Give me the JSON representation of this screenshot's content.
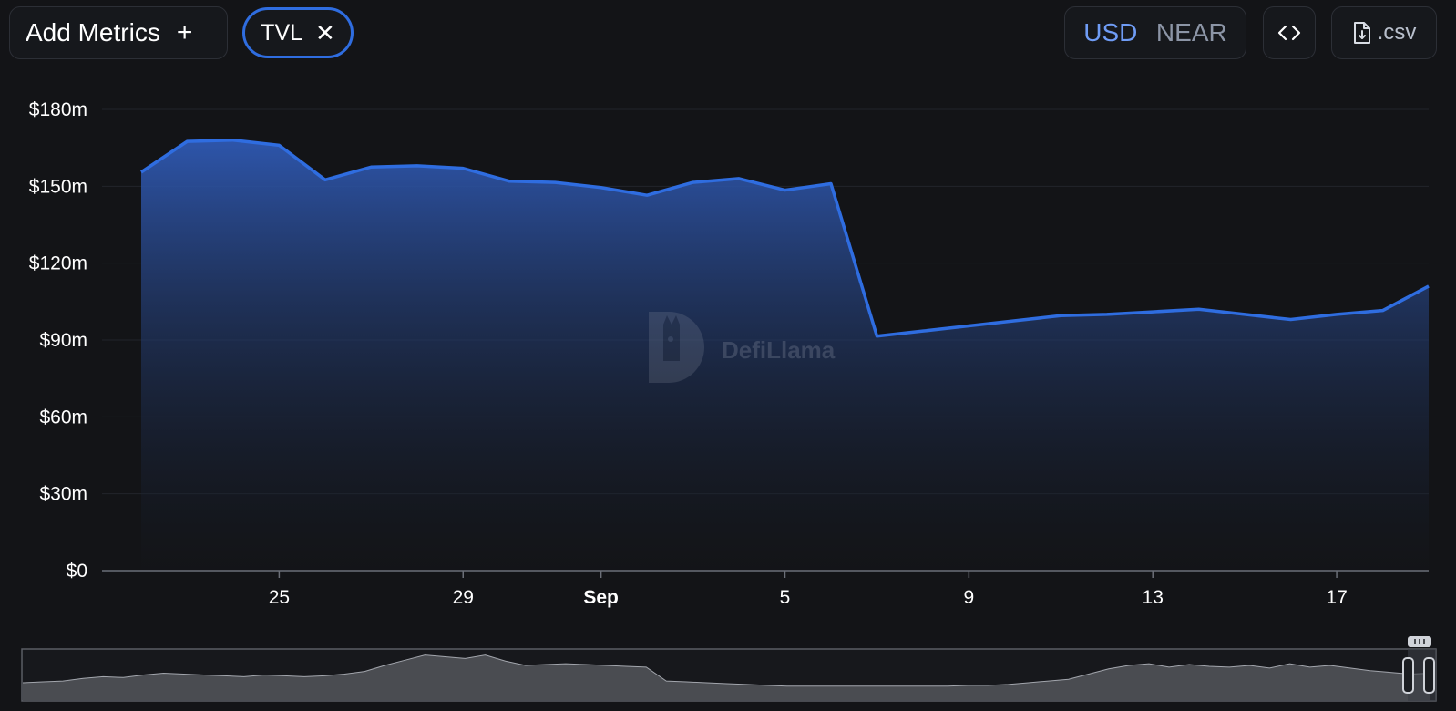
{
  "toolbar": {
    "add_metrics_label": "Add Metrics",
    "add_icon": "plus-icon",
    "metric_pill_label": "TVL",
    "remove_icon": "close-icon",
    "currency_options": [
      "USD",
      "NEAR"
    ],
    "currency_selected": "USD",
    "embed_icon": "code-icon",
    "csv_label": ".csv",
    "csv_icon": "file-download-icon"
  },
  "watermark": {
    "text": "DefiLlama",
    "icon": "llama-logo-icon"
  },
  "colors": {
    "background": "#131417",
    "line": "#2f6de0",
    "accent": "#6f9cf5",
    "brush_fill": "#4a4c51",
    "brush_line": "#a3a6ad"
  },
  "chart_data": {
    "type": "area",
    "x": [
      "2024-08-22",
      "2024-08-23",
      "2024-08-24",
      "2024-08-25",
      "2024-08-26",
      "2024-08-27",
      "2024-08-28",
      "2024-08-29",
      "2024-08-30",
      "2024-08-31",
      "2024-09-01",
      "2024-09-02",
      "2024-09-03",
      "2024-09-04",
      "2024-09-05",
      "2024-09-06",
      "2024-09-07",
      "2024-09-08",
      "2024-09-09",
      "2024-09-10",
      "2024-09-11",
      "2024-09-12",
      "2024-09-13",
      "2024-09-14",
      "2024-09-15",
      "2024-09-16",
      "2024-09-17",
      "2024-09-18",
      "2024-09-19"
    ],
    "series": [
      {
        "values": [
          155.5,
          167.5,
          168,
          166,
          152.5,
          157.5,
          158,
          157,
          152,
          151.5,
          149.5,
          146.5,
          151.5,
          153,
          148.5,
          151,
          91.5,
          93.5,
          95.5,
          97.5,
          99.5,
          100,
          101,
          102,
          100,
          98,
          100,
          101.5,
          111
        ]
      }
    ],
    "ylim": [
      0,
      180
    ],
    "y_ticks": [
      "$0",
      "$30m",
      "$60m",
      "$90m",
      "$120m",
      "$150m",
      "$180m"
    ],
    "x_ticks": [
      {
        "label": "25",
        "date": "2024-08-25",
        "bold": false
      },
      {
        "label": "29",
        "date": "2024-08-29",
        "bold": false
      },
      {
        "label": "Sep",
        "date": "2024-09-01",
        "bold": true
      },
      {
        "label": "5",
        "date": "2024-09-05",
        "bold": false
      },
      {
        "label": "9",
        "date": "2024-09-09",
        "bold": false
      },
      {
        "label": "13",
        "date": "2024-09-13",
        "bold": false
      },
      {
        "label": "17",
        "date": "2024-09-17",
        "bold": false
      }
    ],
    "grid": true,
    "legend": "none",
    "brush": {
      "overview_values": [
        20,
        21,
        22,
        25,
        27,
        26,
        29,
        31,
        30,
        29,
        28,
        27,
        29,
        28,
        27,
        28,
        30,
        33,
        40,
        46,
        52,
        50,
        48,
        52,
        45,
        40,
        41,
        42,
        41,
        40,
        39,
        38,
        22,
        21,
        20,
        19,
        18,
        17,
        16,
        16,
        16,
        16,
        16,
        16,
        16,
        16,
        16,
        17,
        17,
        18,
        20,
        22,
        24,
        30,
        36,
        40,
        42,
        38,
        41,
        39,
        38,
        40,
        37,
        42,
        38,
        40,
        37,
        34,
        32,
        30,
        31
      ]
    }
  }
}
